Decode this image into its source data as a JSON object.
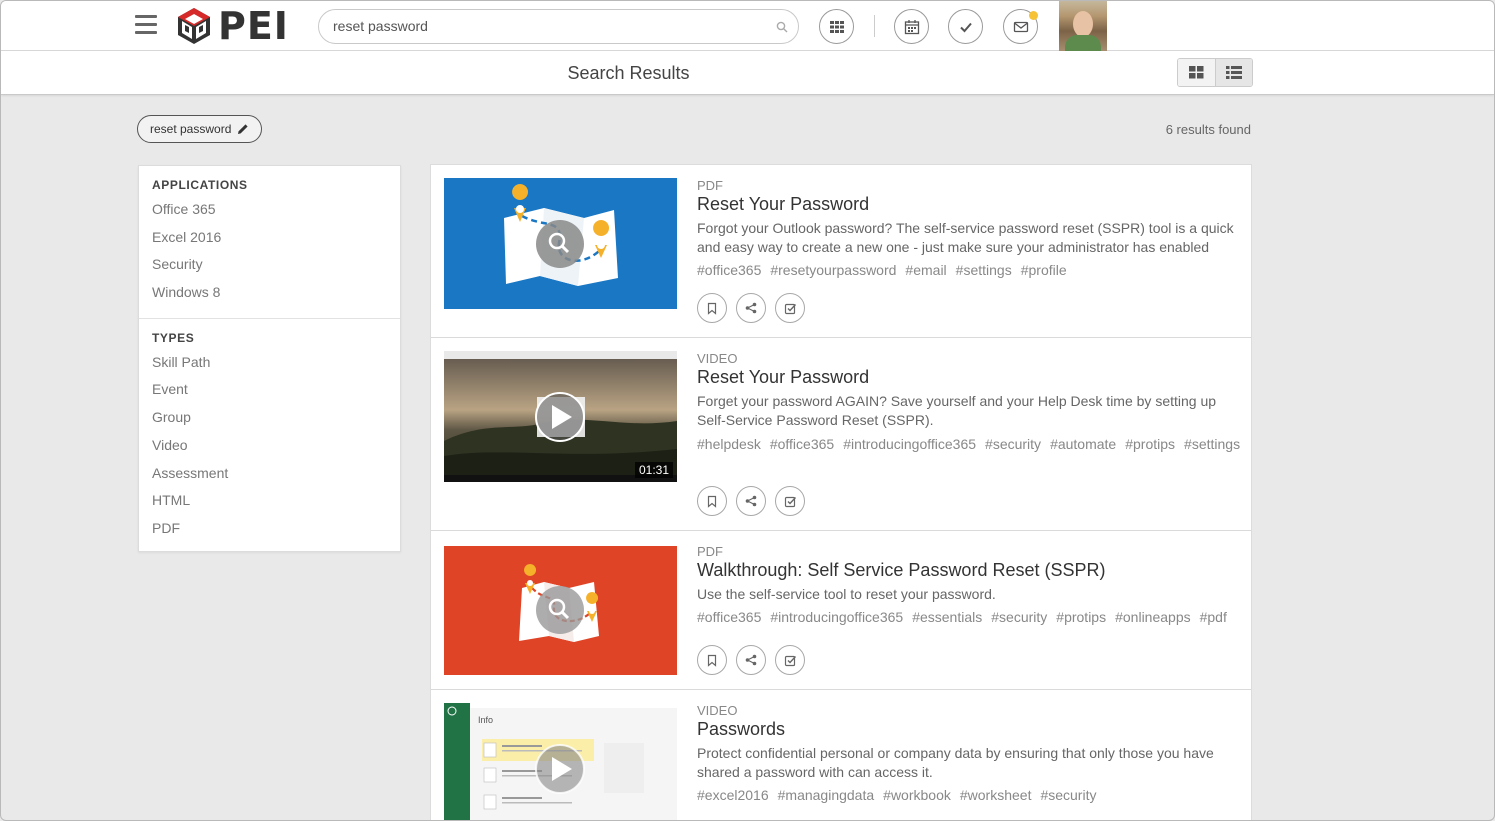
{
  "header": {
    "logo_text": "PEI",
    "search_value": "reset password"
  },
  "subheader": {
    "title": "Search Results"
  },
  "filter": {
    "chip_label": "reset password",
    "results_count": "6 results found"
  },
  "sidebar": {
    "applications_heading": "APPLICATIONS",
    "applications": [
      "Office 365",
      "Excel 2016",
      "Security",
      "Windows 8"
    ],
    "types_heading": "TYPES",
    "types": [
      "Skill Path",
      "Event",
      "Group",
      "Video",
      "Assessment",
      "HTML",
      "PDF"
    ]
  },
  "results": [
    {
      "type": "PDF",
      "title": "Reset Your Password",
      "description": "Forgot your Outlook password? The self-service password reset (SSPR) tool is a quick and easy way to create a new one - just make sure your administrator has enabled th…",
      "tags": [
        "#office365",
        "#resetyourpassword",
        "#email",
        "#settings",
        "#profile"
      ],
      "thumb_color": "#1a77c4"
    },
    {
      "type": "VIDEO",
      "title": "Reset Your Password",
      "description": "Forget your password AGAIN? Save yourself and your Help Desk time by setting up Self-Service Password Reset (SSPR).",
      "tags": [
        "#helpdesk",
        "#office365",
        "#introducingoffice365",
        "#security",
        "#automate",
        "#protips",
        "#settings"
      ],
      "duration": "01:31"
    },
    {
      "type": "PDF",
      "title": "Walkthrough: Self Service Password Reset (SSPR)",
      "description": "Use the self-service tool to reset your password.",
      "tags": [
        "#office365",
        "#introducingoffice365",
        "#essentials",
        "#security",
        "#protips",
        "#onlineapps",
        "#pdf"
      ],
      "thumb_color": "#e04427"
    },
    {
      "type": "VIDEO",
      "title": "Passwords",
      "description": "Protect confidential personal or company data by ensuring that only those you have shared a password with can access it.",
      "tags": [
        "#excel2016",
        "#managingdata",
        "#workbook",
        "#worksheet",
        "#security"
      ],
      "thumb_label": "Info"
    }
  ]
}
